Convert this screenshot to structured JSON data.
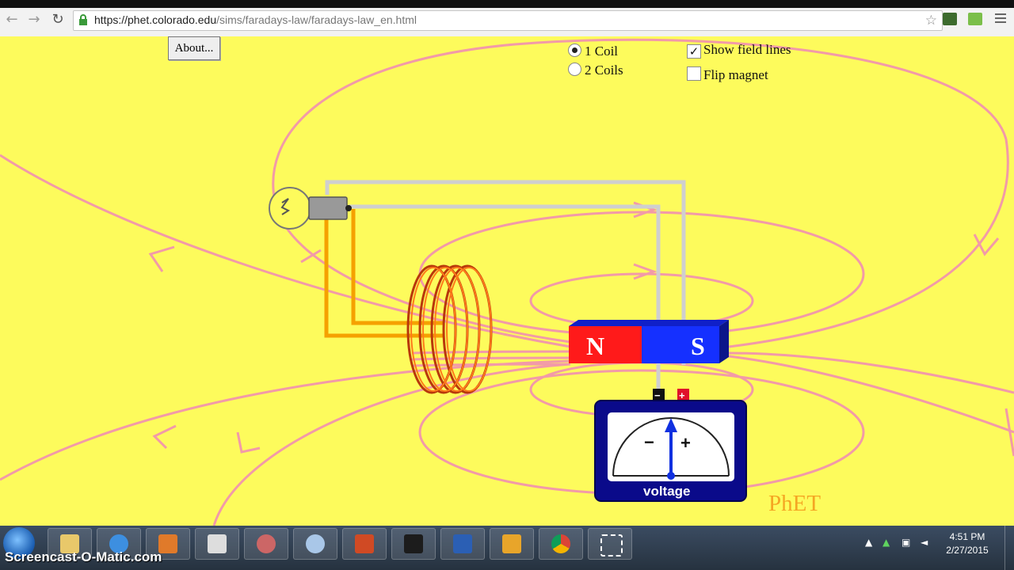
{
  "browser": {
    "url_host": "https://phet.colorado.edu",
    "url_path": "/sims/faradays-law/faradays-law_en.html",
    "back_icon": "back-arrow-icon",
    "forward_icon": "forward-arrow-icon",
    "reload_icon": "reload-icon"
  },
  "sim": {
    "about_label": "About...",
    "coil_options": [
      {
        "label": "1 Coil",
        "selected": true
      },
      {
        "label": "2 Coils",
        "selected": false
      }
    ],
    "checkboxes": [
      {
        "label": "Show field lines",
        "checked": true
      },
      {
        "label": "Flip magnet",
        "checked": false
      }
    ],
    "magnet": {
      "north": "N",
      "south": "S",
      "north_color": "#ff1a1a",
      "south_color": "#1530ff"
    },
    "meter": {
      "minus": "−",
      "plus": "+",
      "label": "voltage",
      "terminal_minus": "−",
      "terminal_plus": "+"
    },
    "logo": "PhET",
    "background_color": "#fdfb5c",
    "field_line_color": "#f29aa8"
  },
  "taskbar": {
    "watermark": "Screencast-O-Matic.com",
    "time": "4:51 PM",
    "date": "2/27/2015"
  }
}
